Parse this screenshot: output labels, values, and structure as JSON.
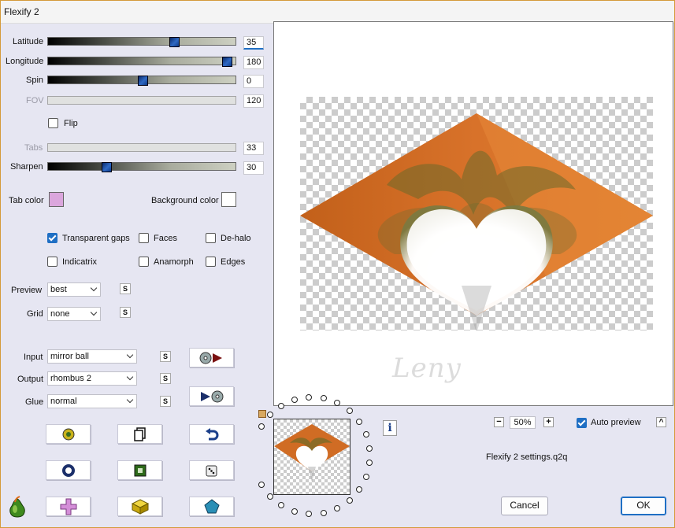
{
  "window": {
    "title": "Flexify 2"
  },
  "sliders": [
    {
      "key": "latitude",
      "label": "Latitude",
      "value": "35",
      "pos": 0.68,
      "enabled": true,
      "active": true
    },
    {
      "key": "longitude",
      "label": "Longitude",
      "value": "180",
      "pos": 0.975,
      "enabled": true
    },
    {
      "key": "spin",
      "label": "Spin",
      "value": "0",
      "pos": 0.5,
      "enabled": true
    },
    {
      "key": "fov",
      "label": "FOV",
      "value": "120",
      "enabled": false
    },
    {
      "key": "tabs",
      "label": "Tabs",
      "value": "33",
      "enabled": false
    },
    {
      "key": "sharpen",
      "label": "Sharpen",
      "value": "30",
      "pos": 0.3,
      "enabled": true
    }
  ],
  "flip": {
    "label": "Flip",
    "checked": false
  },
  "tab_color": {
    "label": "Tab color",
    "color": "#dba6dd"
  },
  "background_color": {
    "label": "Background color",
    "color": "#ffffff"
  },
  "options": {
    "transparent_gaps": {
      "label": "Transparent gaps",
      "checked": true
    },
    "faces": {
      "label": "Faces",
      "checked": false
    },
    "de_halo": {
      "label": "De-halo",
      "checked": false
    },
    "indicatrix": {
      "label": "Indicatrix",
      "checked": false
    },
    "anamorph": {
      "label": "Anamorph",
      "checked": false
    },
    "edges": {
      "label": "Edges",
      "checked": false
    }
  },
  "preview_select": {
    "label": "Preview",
    "value": "best"
  },
  "grid_select": {
    "label": "Grid",
    "value": "none"
  },
  "input_select": {
    "label": "Input",
    "value": "mirror ball"
  },
  "output_select": {
    "label": "Output",
    "value": "rhombus 2"
  },
  "glue_select": {
    "label": "Glue",
    "value": "normal"
  },
  "s_label": "S",
  "zoom": {
    "minus": "−",
    "value": "50%",
    "plus": "+"
  },
  "auto_preview": {
    "label": "Auto preview",
    "checked": true
  },
  "collapse_label": "^",
  "info_label": "i",
  "settings_file": "Flexify 2 settings.q2q",
  "watermark": "Leny",
  "buttons": {
    "cancel": "Cancel",
    "ok": "OK"
  },
  "colors": {
    "accent": "#1f6fc4",
    "window_bg": "#e6e6f2",
    "frame": "#d49a3a"
  }
}
